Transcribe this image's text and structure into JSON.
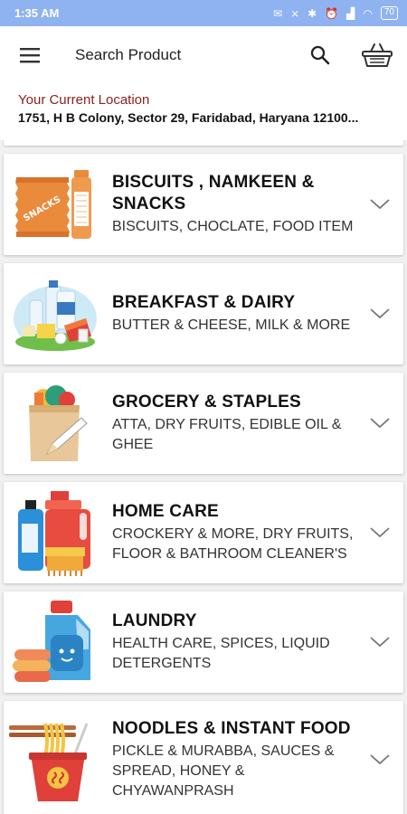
{
  "status_bar": {
    "time": "1:35 AM",
    "battery": "70"
  },
  "app_bar": {
    "search_label": "Search Product",
    "menu_icon": "hamburger-menu-icon",
    "search_icon": "search-icon",
    "basket_icon": "basket-icon"
  },
  "location": {
    "label": "Your Current Location",
    "address": "1751, H B Colony, Sector 29, Faridabad, Haryana 12100..."
  },
  "categories": [
    {
      "title": "BISCUITS , NAMKEEN & SNACKS",
      "subtitle": "BISCUITS, CHOCLATE, FOOD ITEM",
      "icon": "snacks-icon"
    },
    {
      "title": "BREAKFAST & DAIRY",
      "subtitle": "BUTTER & CHEESE, MILK & MORE",
      "icon": "dairy-icon"
    },
    {
      "title": "GROCERY & STAPLES",
      "subtitle": "ATTA, DRY FRUITS, EDIBLE OIL & GHEE",
      "icon": "grocery-bag-icon"
    },
    {
      "title": "HOME CARE",
      "subtitle": "CROCKERY & MORE, DRY FRUITS, FLOOR & BATHROOM CLEANER'S",
      "icon": "cleaning-bottles-icon"
    },
    {
      "title": "LAUNDRY",
      "subtitle": "HEALTH CARE, SPICES, LIQUID DETERGENTS",
      "icon": "detergent-icon"
    },
    {
      "title": "NOODLES & INSTANT FOOD",
      "subtitle": "PICKLE & MURABBA, SAUCES & SPREAD, HONEY & CHYAWANPRASH",
      "icon": "noodles-cup-icon"
    }
  ],
  "snacks_pack_text": "SNACKS",
  "colors": {
    "status_bar": "#8fb2f0",
    "location_label": "#8b1e1e"
  }
}
